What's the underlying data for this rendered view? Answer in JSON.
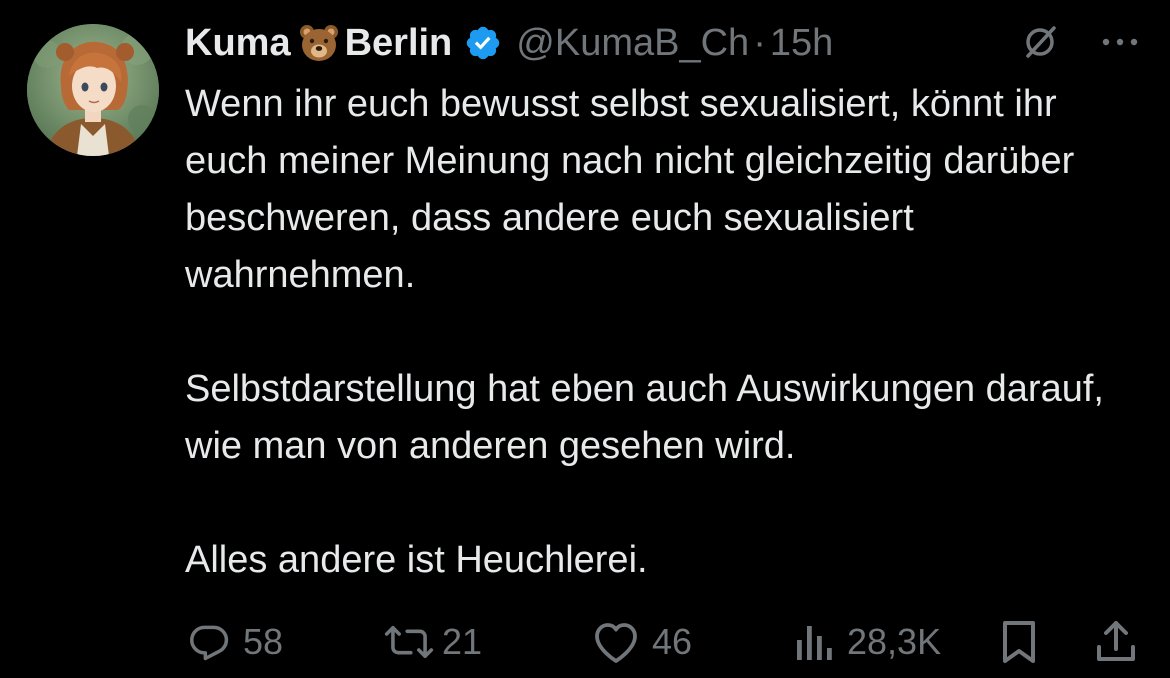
{
  "author": {
    "name_part1": "Kuma",
    "name_emoji": "bear-face-emoji",
    "name_part2": "Berlin",
    "verified": true,
    "handle": "@KumaB_Ch",
    "separator": "·",
    "time": "15h"
  },
  "tweet": {
    "paragraphs": [
      "Wenn ihr euch bewusst selbst sexualisiert, könnt ihr euch meiner Meinung nach nicht gleichzeitig darüber beschweren, dass andere euch sexualisiert wahrnehmen.",
      "Selbstdarstellung hat eben auch Auswirkungen darauf, wie man von anderen gesehen wird.",
      "Alles andere ist Heuchlerei."
    ]
  },
  "actions": {
    "replies": "58",
    "reposts": "21",
    "likes": "46",
    "views": "28,3K"
  },
  "icons": {
    "top": [
      "grok-icon",
      "more-icon"
    ],
    "actions": [
      "reply-icon",
      "repost-icon",
      "like-icon",
      "views-icon",
      "bookmark-icon",
      "share-icon"
    ]
  },
  "colors": {
    "background": "#000000",
    "text": "#e7e9ea",
    "secondary": "#71767b",
    "verified_blue": "#1d9bf0"
  }
}
